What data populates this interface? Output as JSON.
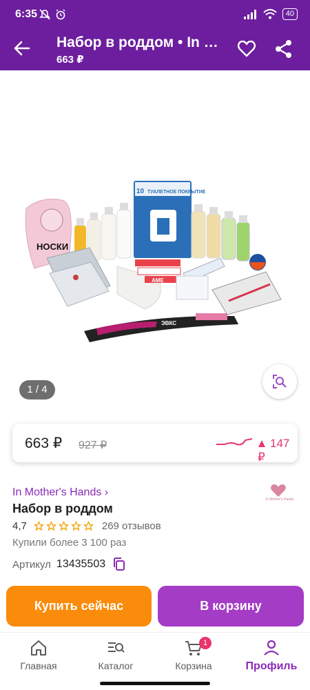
{
  "status": {
    "time": "6:35",
    "battery": "40"
  },
  "appbar": {
    "title": "Набор в роддом • In Mother's Hands",
    "subtitle": "663 ₽"
  },
  "gallery": {
    "counter": "1 / 4",
    "photo_texts": {
      "socks_label": "НОСКИ",
      "cover_count": "10",
      "cover_title": "ТУАЛЕТНОЕ ПОКРЫТИЕ",
      "toothbrush_label": "ЭВКС",
      "cream_label": "AME"
    }
  },
  "price": {
    "current": "663 ₽",
    "old": "927 ₽",
    "delta": "147 ₽",
    "accent": "#e6356f"
  },
  "product": {
    "brand": "In Mother's Hands ›",
    "brand_logo_text": "In Mother's Hands",
    "name": "Набор в роддом",
    "rating": "4,7",
    "rating_value": 4.7,
    "reviews": "269 отзывов",
    "bought": "Купили более 3 100 раз",
    "article_label": "Артикул",
    "article": "13435503"
  },
  "actions": {
    "buy_now": "Купить сейчас",
    "add_to_cart": "В корзину"
  },
  "tabbar": {
    "items": [
      {
        "label": "Главная",
        "icon": "home-icon"
      },
      {
        "label": "Каталог",
        "icon": "catalog-search-icon"
      },
      {
        "label": "Корзина",
        "icon": "cart-icon",
        "badge": "1"
      },
      {
        "label": "Профиль",
        "icon": "profile-icon",
        "active": true
      }
    ]
  },
  "colors": {
    "brand_purple": "#6c1e9e",
    "buy_orange": "#fb8b0a",
    "cart_purple": "#a43cc5"
  }
}
